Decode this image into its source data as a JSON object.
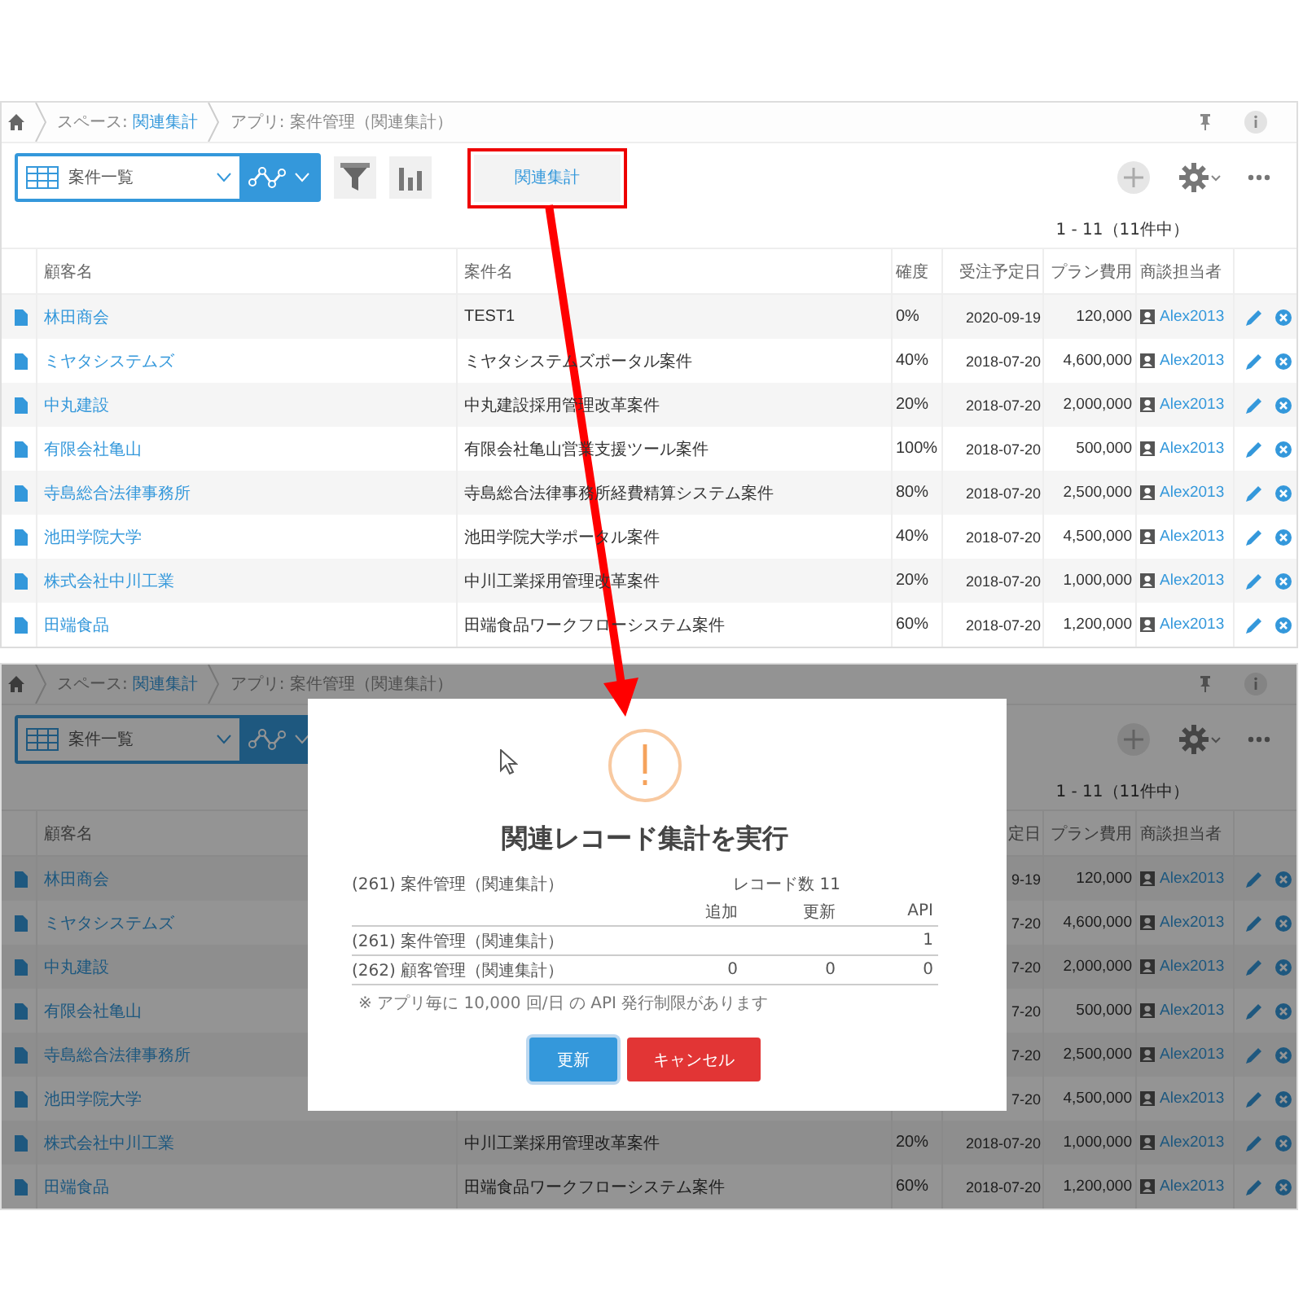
{
  "screens": [
    {
      "breadcrumbs": [
        {
          "label": "スペース:",
          "link": "関連集計"
        },
        {
          "label": "アプリ: 案件管理（関連集計）"
        }
      ],
      "view_select": "案件一覧",
      "aggregate_button": "関連集計",
      "record_count": "1 - 11（11件中）",
      "headers": {
        "customer": "顧客名",
        "case": "案件名",
        "prob": "確度",
        "date": "受注予定日",
        "fee": "プラン費用",
        "owner": "商談担当者"
      },
      "rows": [
        {
          "customer": "林田商会",
          "case": "TEST1",
          "prob": "0%",
          "date": "2020-09-19",
          "fee": "120,000",
          "owner": "Alex2013"
        },
        {
          "customer": "ミヤタシステムズ",
          "case": "ミヤタシステムズポータル案件",
          "prob": "40%",
          "date": "2018-07-20",
          "fee": "4,600,000",
          "owner": "Alex2013"
        },
        {
          "customer": "中丸建設",
          "case": "中丸建設採用管理改革案件",
          "prob": "20%",
          "date": "2018-07-20",
          "fee": "2,000,000",
          "owner": "Alex2013"
        },
        {
          "customer": "有限会社亀山",
          "case": "有限会社亀山営業支援ツール案件",
          "prob": "100%",
          "date": "2018-07-20",
          "fee": "500,000",
          "owner": "Alex2013"
        },
        {
          "customer": "寺島総合法律事務所",
          "case": "寺島総合法律事務所経費精算システム案件",
          "prob": "80%",
          "date": "2018-07-20",
          "fee": "2,500,000",
          "owner": "Alex2013"
        },
        {
          "customer": "池田学院大学",
          "case": "池田学院大学ポータル案件",
          "prob": "40%",
          "date": "2018-07-20",
          "fee": "4,500,000",
          "owner": "Alex2013"
        },
        {
          "customer": "株式会社中川工業",
          "case": "中川工業採用管理改革案件",
          "prob": "20%",
          "date": "2018-07-20",
          "fee": "1,000,000",
          "owner": "Alex2013"
        },
        {
          "customer": "田端食品",
          "case": "田端食品ワークフローシステム案件",
          "prob": "60%",
          "date": "2018-07-20",
          "fee": "1,200,000",
          "owner": "Alex2013"
        }
      ]
    },
    {
      "breadcrumbs": [
        {
          "label": "スペース:",
          "link": "関連集計"
        },
        {
          "label": "アプリ: 案件管理（関連集計）"
        }
      ],
      "view_select": "案件一覧",
      "record_count": "1 - 11（11件中）",
      "headers": {
        "customer": "顧客名",
        "date": "定日",
        "fee": "プラン費用",
        "owner": "商談担当者"
      },
      "rows": [
        {
          "customer": "林田商会",
          "date": "9-19",
          "fee": "120,000",
          "owner": "Alex2013"
        },
        {
          "customer": "ミヤタシステムズ",
          "date": "7-20",
          "fee": "4,600,000",
          "owner": "Alex2013"
        },
        {
          "customer": "中丸建設",
          "date": "7-20",
          "fee": "2,000,000",
          "owner": "Alex2013"
        },
        {
          "customer": "有限会社亀山",
          "date": "7-20",
          "fee": "500,000",
          "owner": "Alex2013"
        },
        {
          "customer": "寺島総合法律事務所",
          "date": "7-20",
          "fee": "2,500,000",
          "owner": "Alex2013"
        },
        {
          "customer": "池田学院大学",
          "date": "7-20",
          "fee": "4,500,000",
          "owner": "Alex2013"
        },
        {
          "customer": "株式会社中川工業",
          "case": "中川工業採用管理改革案件",
          "prob": "20%",
          "date": "2018-07-20",
          "fee": "1,000,000",
          "owner": "Alex2013"
        },
        {
          "customer": "田端食品",
          "case": "田端食品ワークフローシステム案件",
          "prob": "60%",
          "date": "2018-07-20",
          "fee": "1,200,000",
          "owner": "Alex2013"
        }
      ],
      "dialog": {
        "title": "関連レコード集計を実行",
        "source_app": "(261) 案件管理（関連集計）",
        "record_count": "レコード数 11",
        "columns": {
          "added": "追加",
          "updated": "更新",
          "api": "API"
        },
        "rows": [
          {
            "app": "(261) 案件管理（関連集計）",
            "api": "1"
          },
          {
            "app": "(262) 顧客管理（関連集計）",
            "added": "0",
            "updated": "0",
            "api": "0"
          }
        ],
        "note": "※ アプリ毎に 10,000 回/日 の API 発行制限があります",
        "buttons": [
          {
            "label": "更新",
            "kind": "primary"
          },
          {
            "label": "キャンセル",
            "kind": "danger"
          }
        ]
      }
    }
  ]
}
